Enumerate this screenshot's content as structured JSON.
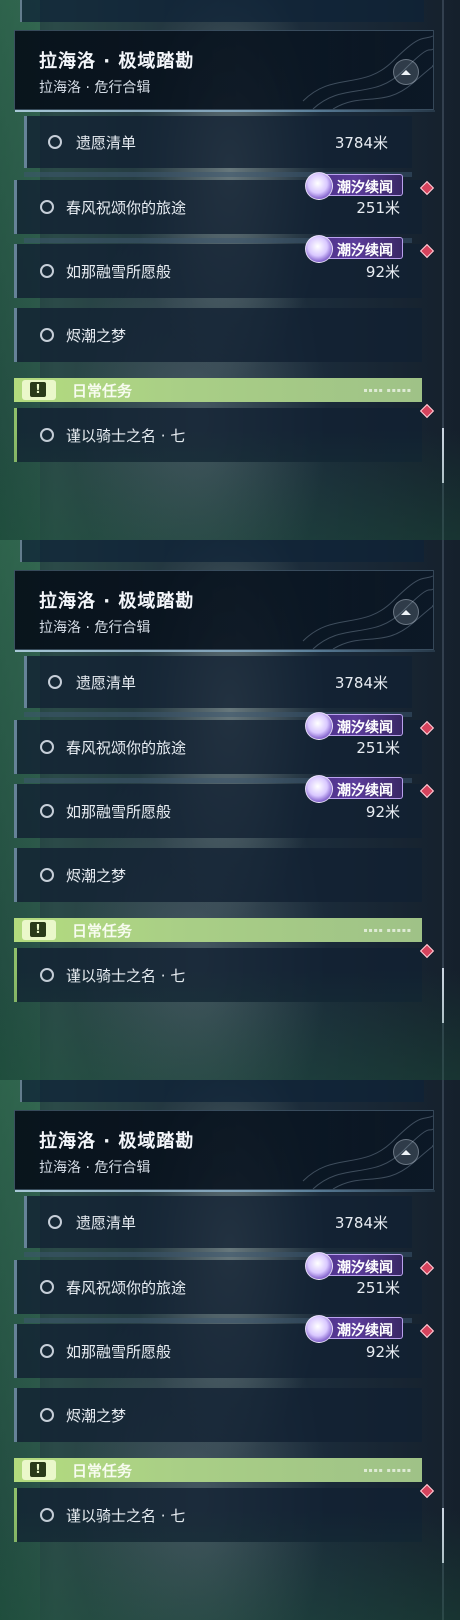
{
  "panels": [
    {
      "header": {
        "title": "拉海洛 · 极域踏勘",
        "subtitle": "拉海洛 · 危行合辑"
      },
      "quests": [
        {
          "name": "遗愿清单",
          "distance": "3784米"
        },
        {
          "name": "春风祝颂你的旅途",
          "distance": "251米",
          "badge": "潮汐续闻"
        },
        {
          "name": "如那融雪所愿般",
          "distance": "92米",
          "badge": "潮汐续闻"
        },
        {
          "name": "烬潮之梦",
          "distance": ""
        }
      ],
      "daily": {
        "title": "日常任务",
        "quests": [
          {
            "name": "谨以骑士之名 · 七"
          }
        ]
      }
    },
    {
      "header": {
        "title": "拉海洛 · 极域踏勘",
        "subtitle": "拉海洛 · 危行合辑"
      },
      "quests": [
        {
          "name": "遗愿清单",
          "distance": "3784米"
        },
        {
          "name": "春风祝颂你的旅途",
          "distance": "251米",
          "badge": "潮汐续闻"
        },
        {
          "name": "如那融雪所愿般",
          "distance": "92米",
          "badge": "潮汐续闻"
        },
        {
          "name": "烬潮之梦",
          "distance": ""
        }
      ],
      "daily": {
        "title": "日常任务",
        "quests": [
          {
            "name": "谨以骑士之名 · 七"
          }
        ]
      }
    },
    {
      "header": {
        "title": "拉海洛 · 极域踏勘",
        "subtitle": "拉海洛 · 危行合辑"
      },
      "quests": [
        {
          "name": "遗愿清单",
          "distance": "3784米"
        },
        {
          "name": "春风祝颂你的旅途",
          "distance": "251米",
          "badge": "潮汐续闻"
        },
        {
          "name": "如那融雪所愿般",
          "distance": "92米",
          "badge": "潮汐续闻"
        },
        {
          "name": "烬潮之梦",
          "distance": ""
        }
      ],
      "daily": {
        "title": "日常任务",
        "quests": [
          {
            "name": "谨以骑士之名 · 七"
          }
        ]
      }
    }
  ],
  "colors": {
    "badge_purple": "#5b3c9a",
    "daily_green": "#b3db7e",
    "marker_red": "#d6435d"
  },
  "icons": {
    "collapse": "chevron-up-icon",
    "quest_marker": "ring-icon",
    "badge_emblem": "tidal-emblem-icon",
    "daily": "exclamation-icon",
    "tracked": "red-diamond-icon"
  }
}
